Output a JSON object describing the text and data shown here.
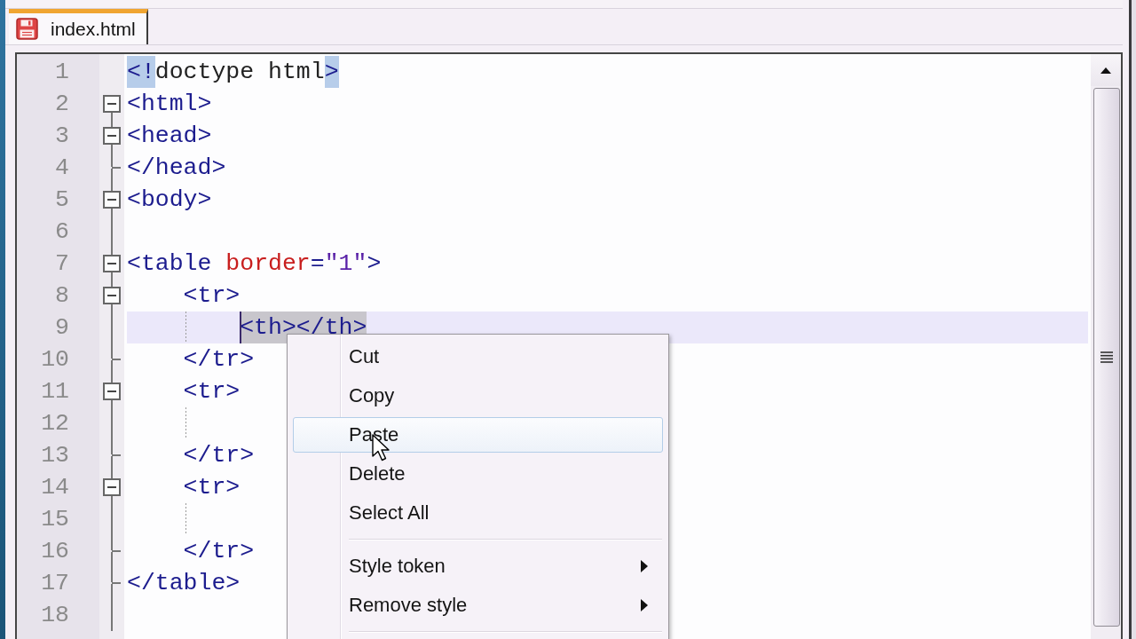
{
  "tabs": [
    {
      "label": "index.html",
      "selected": true
    }
  ],
  "editor": {
    "lines": [
      {
        "number": "1",
        "kind": "plain",
        "current": false,
        "tokens": [
          {
            "text": "<!",
            "kind": "tag",
            "brace_match": true,
            "selected": false
          },
          {
            "text": "doctype html",
            "kind": "plain",
            "brace_match": false,
            "selected": false
          },
          {
            "text": ">",
            "kind": "tag",
            "brace_match": true,
            "selected": false
          }
        ]
      },
      {
        "number": "2",
        "kind": "header",
        "current": false,
        "tokens": [
          {
            "text": "<html>",
            "kind": "tag",
            "brace_match": false,
            "selected": false
          }
        ]
      },
      {
        "number": "3",
        "kind": "header",
        "current": false,
        "tokens": [
          {
            "text": "<head>",
            "kind": "tag",
            "brace_match": false,
            "selected": false
          }
        ]
      },
      {
        "number": "4",
        "kind": "footer",
        "current": false,
        "tokens": [
          {
            "text": "</head>",
            "kind": "tag",
            "brace_match": false,
            "selected": false
          }
        ]
      },
      {
        "number": "5",
        "kind": "header",
        "current": false,
        "tokens": [
          {
            "text": "<body>",
            "kind": "tag",
            "brace_match": false,
            "selected": false
          }
        ]
      },
      {
        "number": "6",
        "kind": "body",
        "current": false
      },
      {
        "number": "7",
        "kind": "header",
        "current": false,
        "tokens": [
          {
            "text": "<table",
            "kind": "tag",
            "brace_match": false,
            "selected": false
          },
          {
            "text": " border",
            "kind": "attr",
            "brace_match": false,
            "selected": false
          },
          {
            "text": "=",
            "kind": "tag",
            "brace_match": false,
            "selected": false
          },
          {
            "text": "\"1\"",
            "kind": "value",
            "brace_match": false,
            "selected": false
          },
          {
            "text": ">",
            "kind": "tag",
            "brace_match": false,
            "selected": false
          }
        ],
        "children": [
          {
            "number": "8",
            "kind": "header",
            "current": false,
            "tokens": [
              {
                "text": "<tr>",
                "kind": "tag",
                "brace_match": false,
                "selected": false
              }
            ],
            "children": [
              {
                "number": "9",
                "kind": "body",
                "current": true,
                "tokens": [
                  {
                    "kind": "caret"
                  },
                  {
                    "text": "<th></th>",
                    "kind": "tag",
                    "brace_match": false,
                    "selected": true
                  }
                ]
              }
            ]
          },
          {
            "number": "10",
            "kind": "footer",
            "current": false,
            "tokens": [
              {
                "text": "</tr>",
                "kind": "tag",
                "brace_match": false,
                "selected": false
              }
            ]
          },
          {
            "number": "11",
            "kind": "header",
            "current": false,
            "tokens": [
              {
                "text": "<tr>",
                "kind": "tag",
                "brace_match": false,
                "selected": false
              }
            ],
            "children": [
              {
                "number": "12",
                "kind": "body",
                "current": false
              }
            ]
          },
          {
            "number": "13",
            "kind": "footer",
            "current": false,
            "tokens": [
              {
                "text": "</tr>",
                "kind": "tag",
                "brace_match": false,
                "selected": false
              }
            ]
          },
          {
            "number": "14",
            "kind": "header",
            "current": false,
            "tokens": [
              {
                "text": "<tr>",
                "kind": "tag",
                "brace_match": false,
                "selected": false
              }
            ],
            "children": [
              {
                "number": "15",
                "kind": "body",
                "current": false
              }
            ]
          },
          {
            "number": "16",
            "kind": "footer",
            "current": false,
            "tokens": [
              {
                "text": "</tr>",
                "kind": "tag",
                "brace_match": false,
                "selected": false
              }
            ]
          }
        ]
      },
      {
        "number": "17",
        "kind": "footer",
        "current": false,
        "tokens": [
          {
            "text": "</table>",
            "kind": "tag",
            "brace_match": false,
            "selected": false
          }
        ]
      },
      {
        "number": "18",
        "kind": "body",
        "current": false
      }
    ]
  },
  "context_menu": {
    "items": [
      {
        "kind": "command",
        "label": "Cut",
        "selected": false
      },
      {
        "kind": "command",
        "label": "Copy",
        "selected": false
      },
      {
        "kind": "command",
        "label": "Paste",
        "selected": true
      },
      {
        "kind": "command",
        "label": "Delete",
        "selected": false
      },
      {
        "kind": "command",
        "label": "Select All",
        "selected": false
      },
      {
        "kind": "separator"
      },
      {
        "kind": "submenu",
        "label": "Style token",
        "selected": false
      },
      {
        "kind": "submenu",
        "label": "Remove style",
        "selected": false
      },
      {
        "kind": "separator"
      }
    ]
  }
}
